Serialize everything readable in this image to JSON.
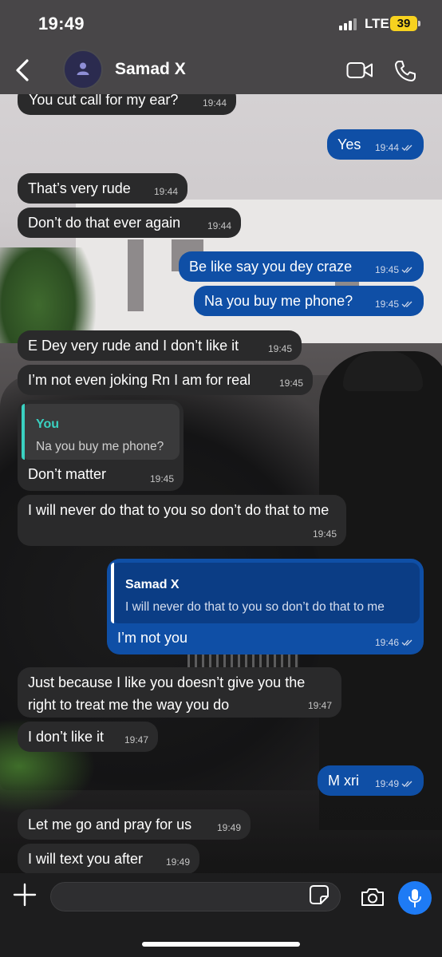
{
  "status": {
    "time": "19:49",
    "network": "LTE",
    "battery": "39"
  },
  "header": {
    "contact_name": "Samad X"
  },
  "messages": [
    {
      "dir": "in",
      "text": "You cut call for my ear?",
      "time": "19:44"
    },
    {
      "dir": "out",
      "text": "Yes",
      "time": "19:44"
    },
    {
      "dir": "in",
      "text": "That’s very rude",
      "time": "19:44"
    },
    {
      "dir": "in",
      "text": "Don’t do that ever again",
      "time": "19:44"
    },
    {
      "dir": "out",
      "text": "Be like say you dey craze",
      "time": "19:45"
    },
    {
      "dir": "out",
      "text": "Na you buy me phone?",
      "time": "19:45"
    },
    {
      "dir": "in",
      "text": "E Dey very rude and I don’t like it",
      "time": "19:45"
    },
    {
      "dir": "in",
      "text": "I’m not even joking Rn I am for real",
      "time": "19:45"
    },
    {
      "dir": "in",
      "text": "Don’t matter",
      "time": "19:45",
      "reply": {
        "name": "You",
        "text": "Na you buy me phone?"
      }
    },
    {
      "dir": "in",
      "text": "I will never do that to you so don’t do that to me",
      "time": "19:45"
    },
    {
      "dir": "out",
      "text": "I’m not you",
      "time": "19:46",
      "reply": {
        "name": "Samad X",
        "text": "I will never do that to you so don’t do that to me"
      }
    },
    {
      "dir": "in",
      "text": "Just because I like you doesn’t give you the right to treat me the way you do",
      "time": "19:47"
    },
    {
      "dir": "in",
      "text": "I don’t like it",
      "time": "19:47"
    },
    {
      "dir": "out",
      "text": "M xri",
      "time": "19:49"
    },
    {
      "dir": "in",
      "text": "Let me go and pray for us",
      "time": "19:49"
    },
    {
      "dir": "in",
      "text": "I will text you after",
      "time": "19:49"
    }
  ],
  "input": {
    "placeholder": ""
  },
  "colors": {
    "incoming_bubble": "#2a2a2b",
    "outgoing_bubble": "#0f4fa6",
    "accent": "#1e7bf5",
    "reply_name_in": "#3ad1c1"
  }
}
